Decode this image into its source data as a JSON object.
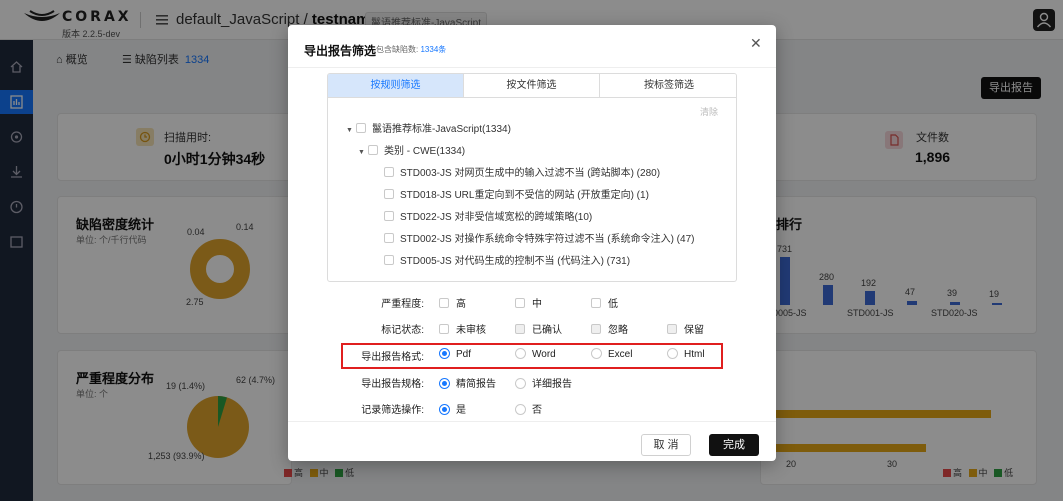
{
  "app": {
    "brand": "CORAX",
    "version": "版本 2.2.5-dev"
  },
  "breadcrumb": {
    "project_group": "default_JavaScript",
    "separator": "/",
    "project": "testname",
    "standard_tag": "鬣语推荐标准-JavaScript"
  },
  "tabs": [
    {
      "label": "概览"
    },
    {
      "label": "缺陷列表",
      "count": "1334"
    }
  ],
  "export_button": "导出报告",
  "stats": {
    "scan_time_label": "扫描用时:",
    "scan_time_value": "0小时1分钟34秒",
    "files_label": "文件数",
    "files_value": "1,896"
  },
  "density_card": {
    "title": "缺陷密度统计",
    "unit": "单位: 个/千行代码",
    "labels": [
      "0.04",
      "0.14",
      "2.75"
    ]
  },
  "rank_card": {
    "title_fragment": "型排行",
    "bar_labels": [
      "731",
      "280",
      "192",
      "47",
      "39",
      "19"
    ],
    "x_labels": [
      "0005-JS",
      "STD001-JS",
      "STD020-JS"
    ]
  },
  "severity_card": {
    "title": "严重程度分布",
    "unit": "单位: 个",
    "labels": [
      "19 (1.4%)",
      "62 (4.7%)",
      "1,253 (93.9%)"
    ],
    "legend": [
      "高",
      "中",
      "低"
    ]
  },
  "right_bottom": {
    "axis": [
      "20",
      "30"
    ],
    "legend": [
      "高",
      "中",
      "低"
    ]
  },
  "colors": {
    "accent": "#1677ff",
    "high": "#e84a4a",
    "mid": "#e6a817",
    "low": "#2ea043",
    "highlight": "#e01f1f"
  },
  "modal": {
    "title": "导出报告筛选",
    "subtitle_prefix": "包含缺陷数:",
    "subtitle_count": "1334条",
    "filter_tabs": [
      "按规则筛选",
      "按文件筛选",
      "按标签筛选"
    ],
    "active_filter_tab": 0,
    "clear": "清除",
    "tree": {
      "root": "鬣语推荐标准-JavaScript(1334)",
      "category": "类别 - CWE(1334)",
      "rules": [
        "STD003-JS 对网页生成中的输入过滤不当 (跨站脚本) (280)",
        "STD018-JS URL重定向到不受信的网站 (开放重定向) (1)",
        "STD022-JS 对非受信域宽松的跨域策略(10)",
        "STD002-JS 对操作系统命令特殊字符过滤不当 (系统命令注入) (47)",
        "STD005-JS 对代码生成的控制不当 (代码注入) (731)"
      ]
    },
    "severity": {
      "label": "严重程度:",
      "options": [
        "高",
        "中",
        "低"
      ]
    },
    "mark_status": {
      "label": "标记状态:",
      "options": [
        "未审核",
        "已确认",
        "忽略",
        "保留"
      ]
    },
    "format": {
      "label": "导出报告格式:",
      "options": [
        "Pdf",
        "Word",
        "Excel",
        "Html"
      ],
      "selected": "Pdf"
    },
    "spec": {
      "label": "导出报告规格:",
      "options": [
        "精简报告",
        "详细报告"
      ],
      "selected": "精简报告"
    },
    "record": {
      "label": "记录筛选操作:",
      "options": [
        "是",
        "否"
      ],
      "selected": "是"
    },
    "cancel": "取 消",
    "confirm": "完成"
  }
}
